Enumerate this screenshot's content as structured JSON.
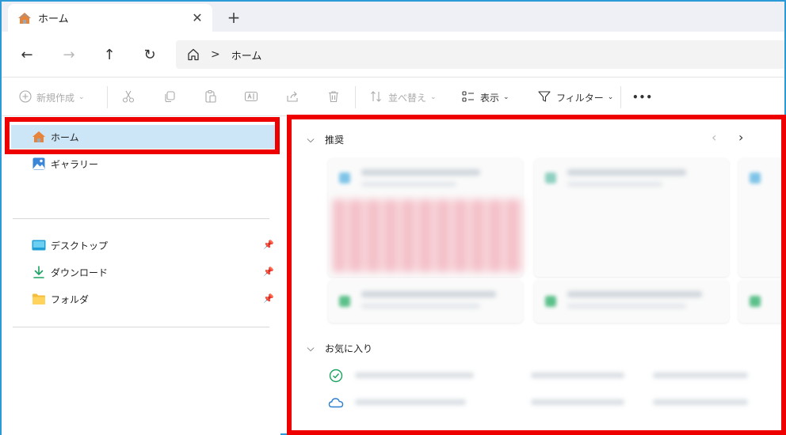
{
  "tab": {
    "title": "ホーム",
    "close": "✕",
    "new_tab": "+"
  },
  "nav": {
    "back": "←",
    "forward": "→",
    "up": "↑",
    "refresh": "↻",
    "separator": ">",
    "address": "ホーム"
  },
  "toolbar": {
    "new_label": "新規作成",
    "sort_label": "並べ替え",
    "view_label": "表示",
    "filter_label": "フィルター",
    "more": "•••",
    "chevron": "⌄"
  },
  "sidebar": {
    "home": "ホーム",
    "gallery": "ギャラリー",
    "quick_access": [
      {
        "label": "デスクトップ",
        "icon": "desktop-icon"
      },
      {
        "label": "ダウンロード",
        "icon": "download-icon"
      },
      {
        "label": "フォルダ",
        "icon": "folder-icon"
      }
    ]
  },
  "main": {
    "recommended": "推奨",
    "favorites": "お気に入り",
    "collapse_chevron": "⌵",
    "prev": "‹",
    "next": "›"
  },
  "colors": {
    "accent": "#2d9ad8",
    "highlight": "#ee0000",
    "selected": "#cce6f7"
  }
}
